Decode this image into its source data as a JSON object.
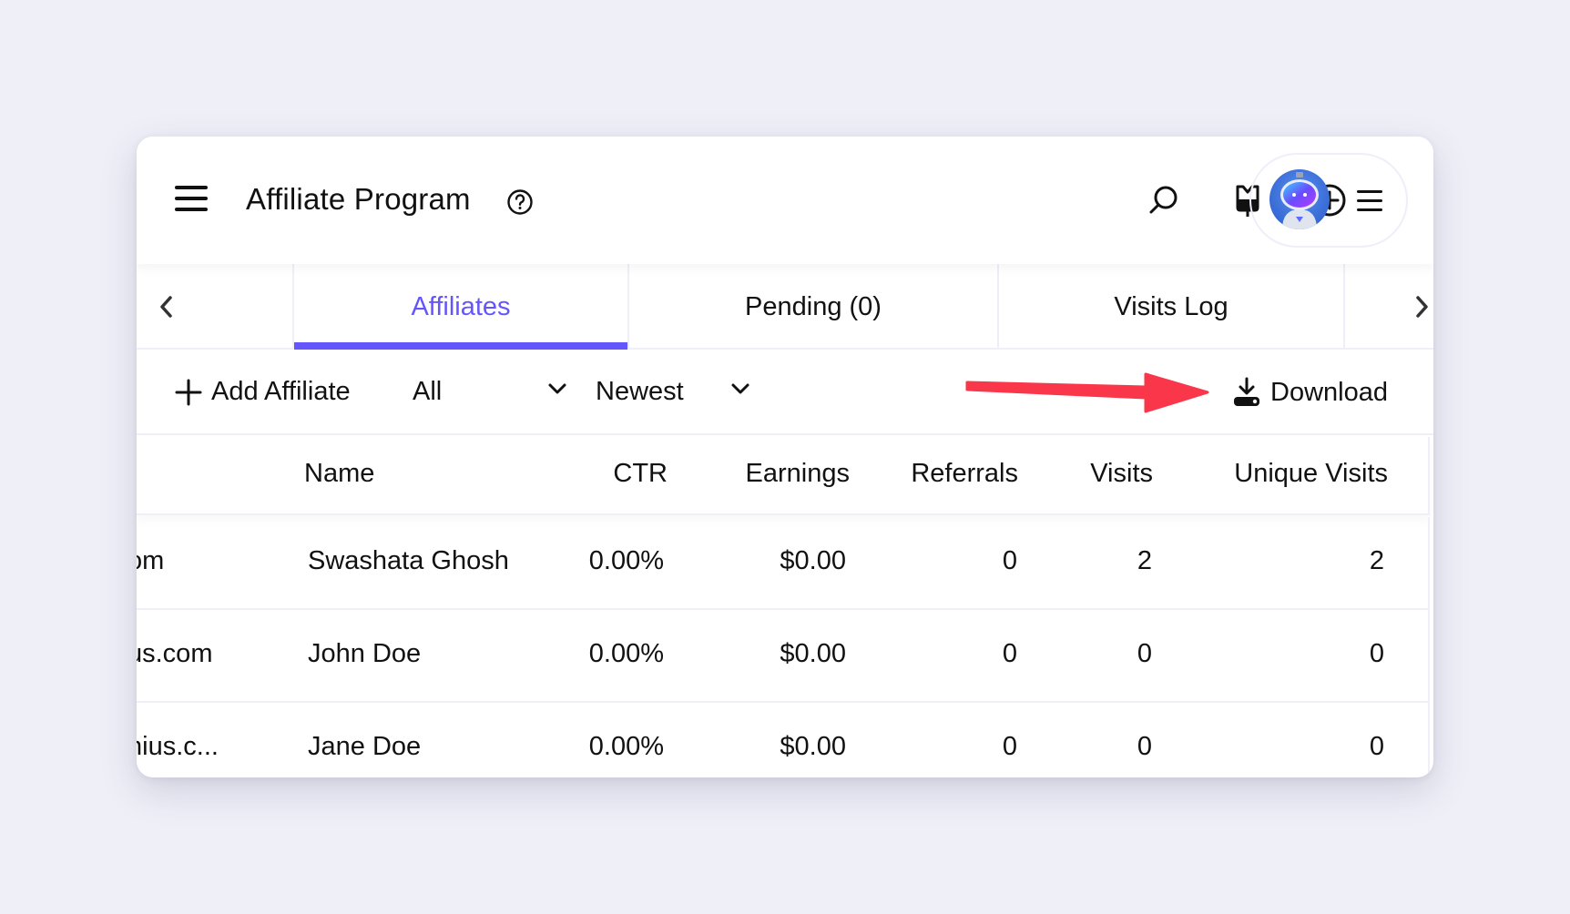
{
  "header": {
    "title": "Affiliate Program",
    "icons": [
      "menu-icon",
      "help-icon",
      "search-icon",
      "shopping-bag-icon",
      "add-circle-icon",
      "avatar",
      "profile-menu-icon"
    ]
  },
  "tabs": [
    {
      "label": "Affiliates",
      "active": true
    },
    {
      "label": "Pending (0)",
      "active": false
    },
    {
      "label": "Visits Log",
      "active": false
    }
  ],
  "toolbar": {
    "add_label": "Add Affiliate",
    "filter_value": "All",
    "sort_value": "Newest",
    "download_label": "Download"
  },
  "colors": {
    "accent": "#6556fc",
    "annotation_arrow": "#f9364a",
    "background": "#efeff8"
  },
  "table": {
    "columns": [
      "Name",
      "CTR",
      "Earnings",
      "Referrals",
      "Visits",
      "Unique Visits"
    ],
    "rows": [
      {
        "email": "om",
        "name": "Swashata Ghosh",
        "ctr": "0.00%",
        "earnings": "$0.00",
        "referrals": "0",
        "visits": "2",
        "unique_visits": "2"
      },
      {
        "email": "us.com",
        "name": "John Doe",
        "ctr": "0.00%",
        "earnings": "$0.00",
        "referrals": "0",
        "visits": "0",
        "unique_visits": "0"
      },
      {
        "email": "nius.c...",
        "name": "Jane Doe",
        "ctr": "0.00%",
        "earnings": "$0.00",
        "referrals": "0",
        "visits": "0",
        "unique_visits": "0"
      }
    ]
  }
}
